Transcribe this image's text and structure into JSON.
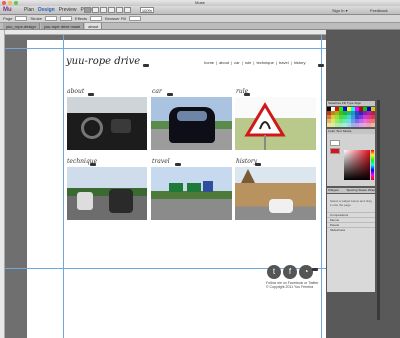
{
  "window": {
    "title": "Muse"
  },
  "app": {
    "logo": "Mu",
    "modes": [
      "Plan",
      "Design",
      "Preview",
      "Publish"
    ],
    "active_mode": "Design",
    "zoom": "100%",
    "signin": "Sign In ▾",
    "feedback": "Feedback"
  },
  "controls": {
    "page_label": "Page",
    "stroke_label": "Stroke",
    "effects_label": "Effects",
    "browser_fill_label": "Browser Fill"
  },
  "tabs": [
    "yuu_rope-design",
    "yuu-rope drive.muse",
    "about"
  ],
  "site": {
    "title": "yuu-rope drive",
    "nav": [
      "home",
      "|",
      "about",
      "|",
      "car",
      "|",
      "rule",
      "|",
      "technique",
      "|",
      "travel",
      "|",
      "history"
    ]
  },
  "sections": [
    {
      "name": "about"
    },
    {
      "name": "car"
    },
    {
      "name": "rule"
    },
    {
      "name": "technique"
    },
    {
      "name": "travel"
    },
    {
      "name": "history"
    }
  ],
  "footer": {
    "icons": [
      "twitter-icon",
      "facebook-icon",
      "rss-icon"
    ],
    "line1": "Follow me on Facebook or Twitter",
    "line2": "© Copyright 2011 Yuu Ferreira"
  },
  "panel": {
    "tabs": [
      "Swatches",
      "Fill",
      "Type",
      "Align"
    ],
    "color_tabs": [
      "Color",
      "Text",
      "Stroke"
    ],
    "list_tabs": [
      "Widgets Library",
      "Spacing",
      "States",
      "Wrap"
    ],
    "list_msg": "Select a widget below and drag it onto the page.",
    "list_rows": [
      "Compositions",
      "Menus",
      "Panels",
      "Slideshows"
    ]
  }
}
